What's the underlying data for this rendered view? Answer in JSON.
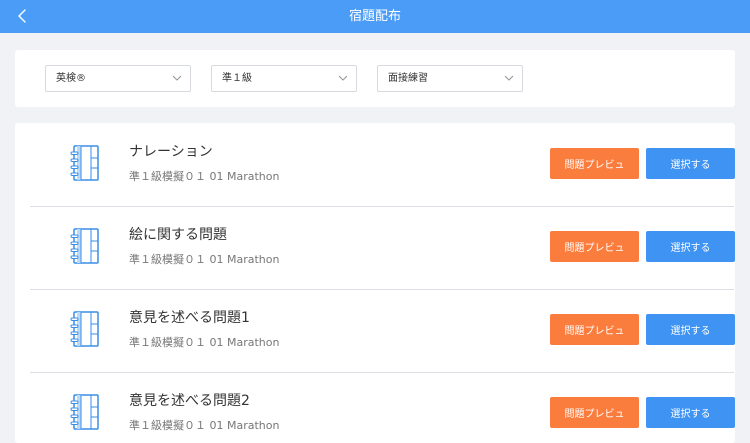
{
  "header": {
    "title": "宿題配布"
  },
  "filters": [
    {
      "value": "英検®"
    },
    {
      "value": "準１級"
    },
    {
      "value": "面接練習"
    }
  ],
  "assignments": [
    {
      "title": "ナレーション",
      "subtitle": "準１級模擬０１ 01 Marathon",
      "preview_label": "問題プレビュ",
      "select_label": "選択する"
    },
    {
      "title": "絵に関する問題",
      "subtitle": "準１級模擬０１ 01 Marathon",
      "preview_label": "問題プレビュ",
      "select_label": "選択する"
    },
    {
      "title": "意見を述べる問題1",
      "subtitle": "準１級模擬０１ 01 Marathon",
      "preview_label": "問題プレビュ",
      "select_label": "選択する"
    },
    {
      "title": "意見を述べる問題2",
      "subtitle": "準１級模擬０１ 01 Marathon",
      "preview_label": "問題プレビュ",
      "select_label": "選択する"
    }
  ],
  "icons": {
    "back": "chevron-left-icon",
    "dropdown": "chevron-down-icon",
    "assignment": "notebook-icon"
  },
  "colors": {
    "header": "#4a9cf7",
    "preview_button": "#fb7d3e",
    "select_button": "#3e93f3",
    "icon": "#3a8ee6"
  }
}
